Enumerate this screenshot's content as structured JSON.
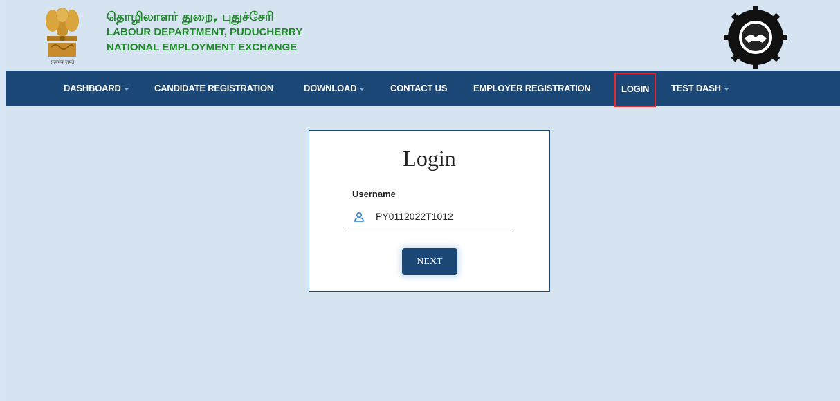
{
  "header": {
    "title_tamil": "தொழிலாளர் துறை, புதுச்சேரி",
    "title_department": "LABOUR DEPARTMENT, PUDUCHERRY",
    "title_exchange": "NATIONAL EMPLOYMENT EXCHANGE",
    "emblem_caption": "सत्यमेव जयते",
    "logo_left": "india-emblem-icon",
    "logo_right": "employment-exchange-seal-icon",
    "brand_color": "#1e8a28"
  },
  "nav": {
    "background": "#1c4878",
    "items": [
      {
        "label": "DASHBOARD",
        "dropdown": true
      },
      {
        "label": "CANDIDATE REGISTRATION",
        "dropdown": false
      },
      {
        "label": "DOWNLOAD",
        "dropdown": true
      },
      {
        "label": "CONTACT US",
        "dropdown": false
      },
      {
        "label": "EMPLOYER REGISTRATION",
        "dropdown": false
      },
      {
        "label": "LOGIN",
        "dropdown": false,
        "highlighted": true,
        "highlight_color": "#e02b2b"
      },
      {
        "label": "TEST DASH",
        "dropdown": true
      }
    ]
  },
  "login": {
    "title": "Login",
    "username_label": "Username",
    "username_value": "PY0112022T1012",
    "username_icon": "user-icon",
    "next_label": "NEXT"
  }
}
